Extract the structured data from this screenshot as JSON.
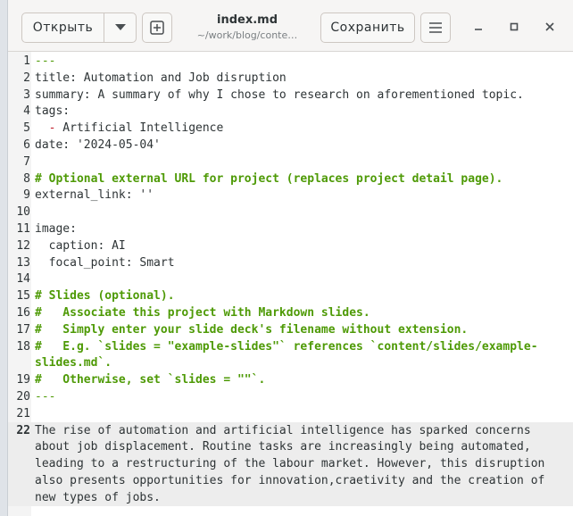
{
  "toolbar": {
    "open_label": "Открыть",
    "save_label": "Сохранить",
    "title": "index.md",
    "subtitle": "~/work/blog/conte…"
  },
  "icons": {
    "dropdown": "chevron-down-icon",
    "new_tab": "plus-box-icon",
    "menu": "hamburger-menu-icon",
    "minimize": "minimize-icon",
    "maximize": "maximize-icon",
    "close": "close-icon"
  },
  "colors": {
    "comment": "#4e9a06",
    "bullet": "#c01c28",
    "text": "#2e3436",
    "current_line": "#ededed"
  },
  "editor": {
    "current_line": "22",
    "lines": [
      {
        "n": "1",
        "text": "---"
      },
      {
        "n": "2",
        "text": "title: Automation and Job disruption"
      },
      {
        "n": "3",
        "text": "summary: A summary of why I chose to research on aforementioned topic."
      },
      {
        "n": "4",
        "text": "tags:"
      },
      {
        "n": "5",
        "bullet": "-",
        "text": " Artificial Intelligence"
      },
      {
        "n": "6",
        "text": "date: '2024-05-04'"
      },
      {
        "n": "7",
        "text": ""
      },
      {
        "n": "8",
        "text": "# Optional external URL for project (replaces project detail page)."
      },
      {
        "n": "9",
        "text": "external_link: ''"
      },
      {
        "n": "10",
        "text": ""
      },
      {
        "n": "11",
        "text": "image:"
      },
      {
        "n": "12",
        "text": "  caption: AI"
      },
      {
        "n": "13",
        "text": "  focal_point: Smart"
      },
      {
        "n": "14",
        "text": ""
      },
      {
        "n": "15",
        "text": "# Slides (optional)."
      },
      {
        "n": "16",
        "text": "#   Associate this project with Markdown slides."
      },
      {
        "n": "17",
        "text": "#   Simply enter your slide deck's filename without extension."
      },
      {
        "n": "18",
        "text": "#   E.g. `slides = \"example-slides\"` references `content/slides/example-",
        "wrap": "slides.md`."
      },
      {
        "n": "19",
        "text": "#   Otherwise, set `slides = \"\"`."
      },
      {
        "n": "20",
        "text": "---"
      },
      {
        "n": "21",
        "text": ""
      },
      {
        "n": "22",
        "text": "The rise of automation and artificial intelligence has sparked concerns",
        "wraps": [
          "about job displacement. Routine tasks are increasingly being automated,",
          "leading to a restructuring of the labour market. However, this disruption",
          "also presents opportunities for innovation,craetivity and the creation of",
          "new types of jobs."
        ]
      }
    ]
  }
}
